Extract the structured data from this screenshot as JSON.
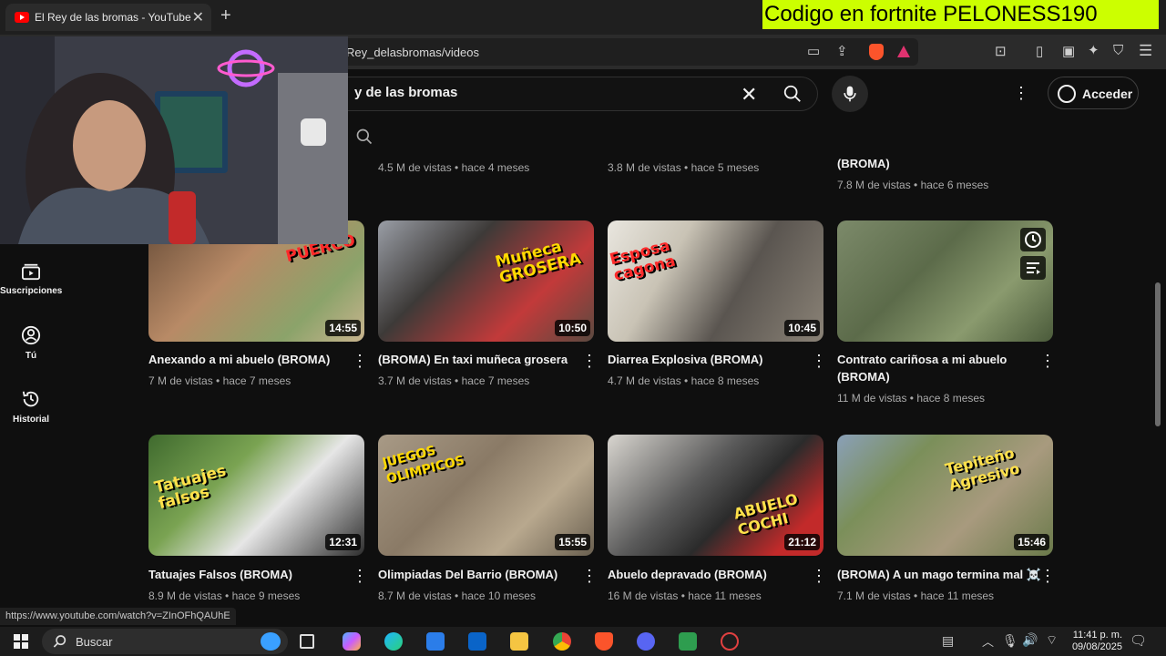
{
  "browser": {
    "tab_title": "El Rey de las bromas - YouTube",
    "url": "Rey_delasbromas/videos",
    "promo_banner": "Codigo en fortnite PELONESS190"
  },
  "header": {
    "search_value": "y de las bromas",
    "signin_label": "Acceder"
  },
  "sidebar": {
    "items": [
      {
        "label": "Suscripciones",
        "icon": "subscriptions-icon"
      },
      {
        "label": "Tú",
        "icon": "user-icon"
      },
      {
        "label": "Historial",
        "icon": "history-icon"
      }
    ]
  },
  "previous_row": [
    {
      "meta": "4.5 M de vistas • hace 4 meses"
    },
    {
      "meta": "3.8 M de vistas • hace 5 meses"
    },
    {
      "title_tail": "(BROMA)",
      "meta": "7.8 M de vistas • hace 6 meses"
    }
  ],
  "videos": [
    {
      "title": "Anexando a mi abuelo (BROMA)",
      "meta": "7 M de vistas • hace 7 meses",
      "duration": "14:55",
      "caption": "PUERCO"
    },
    {
      "title": "(BROMA) En taxi muñeca grosera",
      "meta": "3.7 M de vistas • hace 7 meses",
      "duration": "10:50",
      "caption": "Muñeca\nGROSERA"
    },
    {
      "title": "Diarrea Explosiva (BROMA)",
      "meta": "4.7 M de vistas • hace 8 meses",
      "duration": "10:45",
      "caption": "Esposa\ncagona"
    },
    {
      "title": "Contrato cariñosa a mi abuelo (BROMA)",
      "meta": "11 M de vistas • hace 8 meses",
      "duration": "",
      "caption": ""
    },
    {
      "title": "Tatuajes Falsos (BROMA)",
      "meta": "8.9 M de vistas • hace 9 meses",
      "duration": "12:31",
      "caption": "Tatuajes\nfalsos"
    },
    {
      "title": "Olimpiadas Del Barrio (BROMA)",
      "meta": "8.7 M de vistas • hace 10 meses",
      "duration": "15:55",
      "caption": "JUEGOS\nOLIMPICOS"
    },
    {
      "title": "Abuelo depravado (BROMA)",
      "meta": "16 M de vistas • hace 11 meses",
      "duration": "21:12",
      "caption": "ABUELO\nCOCHI"
    },
    {
      "title": "(BROMA) A un mago termina mal ☠️",
      "meta": "7.1 M de vistas • hace 11 meses",
      "duration": "15:46",
      "caption": "Tepiteño\nAgresivo"
    }
  ],
  "statusbar": {
    "url": "https://www.youtube.com/watch?v=ZInOFhQAUhE"
  },
  "taskbar": {
    "search_label": "Buscar",
    "time": "11:41 p. m.",
    "date": "09/08/2025"
  },
  "colors": {
    "promo_bg": "#ccff00",
    "youtube_red": "#ff0000",
    "bg": "#0f0f0f"
  }
}
